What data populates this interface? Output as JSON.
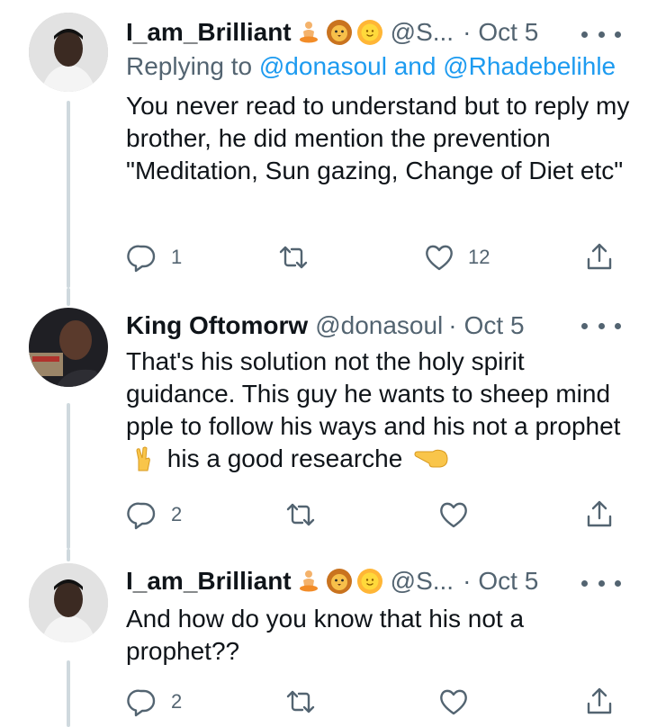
{
  "tweets": [
    {
      "name": "I_am_Brilliant",
      "handle": "@S...",
      "dot": "·",
      "date": "Oct 5",
      "replying_prefix": "Replying to",
      "replying_to": "@donasoul and @Rhadebelihle",
      "body": "You never read to understand but to reply my brother, he did mention the prevention \"Meditation, Sun gazing, Change of Diet etc\"",
      "reply_count": "1",
      "retweet_count": "",
      "like_count": "12",
      "emojis": [
        "person-meditating-icon",
        "lion-face-icon",
        "sun-with-face-icon"
      ]
    },
    {
      "name": "King Oftomorw",
      "handle": "@donasoul",
      "dot": "·",
      "date": "Oct 5",
      "body_part1": "That's his solution not the holy spirit guidance. This guy he wants to sheep mind pple to follow his ways and his not a prophet",
      "body_part2": "his a good researche",
      "reply_count": "2",
      "retweet_count": "",
      "like_count": "",
      "emojis": [
        "crossed-fingers-icon",
        "pointing-left-icon"
      ]
    },
    {
      "name": "I_am_Brilliant",
      "handle": "@S...",
      "dot": "·",
      "date": "Oct 5",
      "body": "And how do you know that his not a prophet??",
      "reply_count": "2",
      "retweet_count": "",
      "like_count": "",
      "emojis": [
        "person-meditating-icon",
        "lion-face-icon",
        "sun-with-face-icon"
      ]
    }
  ],
  "colors": {
    "text": "#0f1419",
    "secondary": "#536471",
    "link": "#1d9bf0",
    "thread_line": "#cfd9de"
  }
}
